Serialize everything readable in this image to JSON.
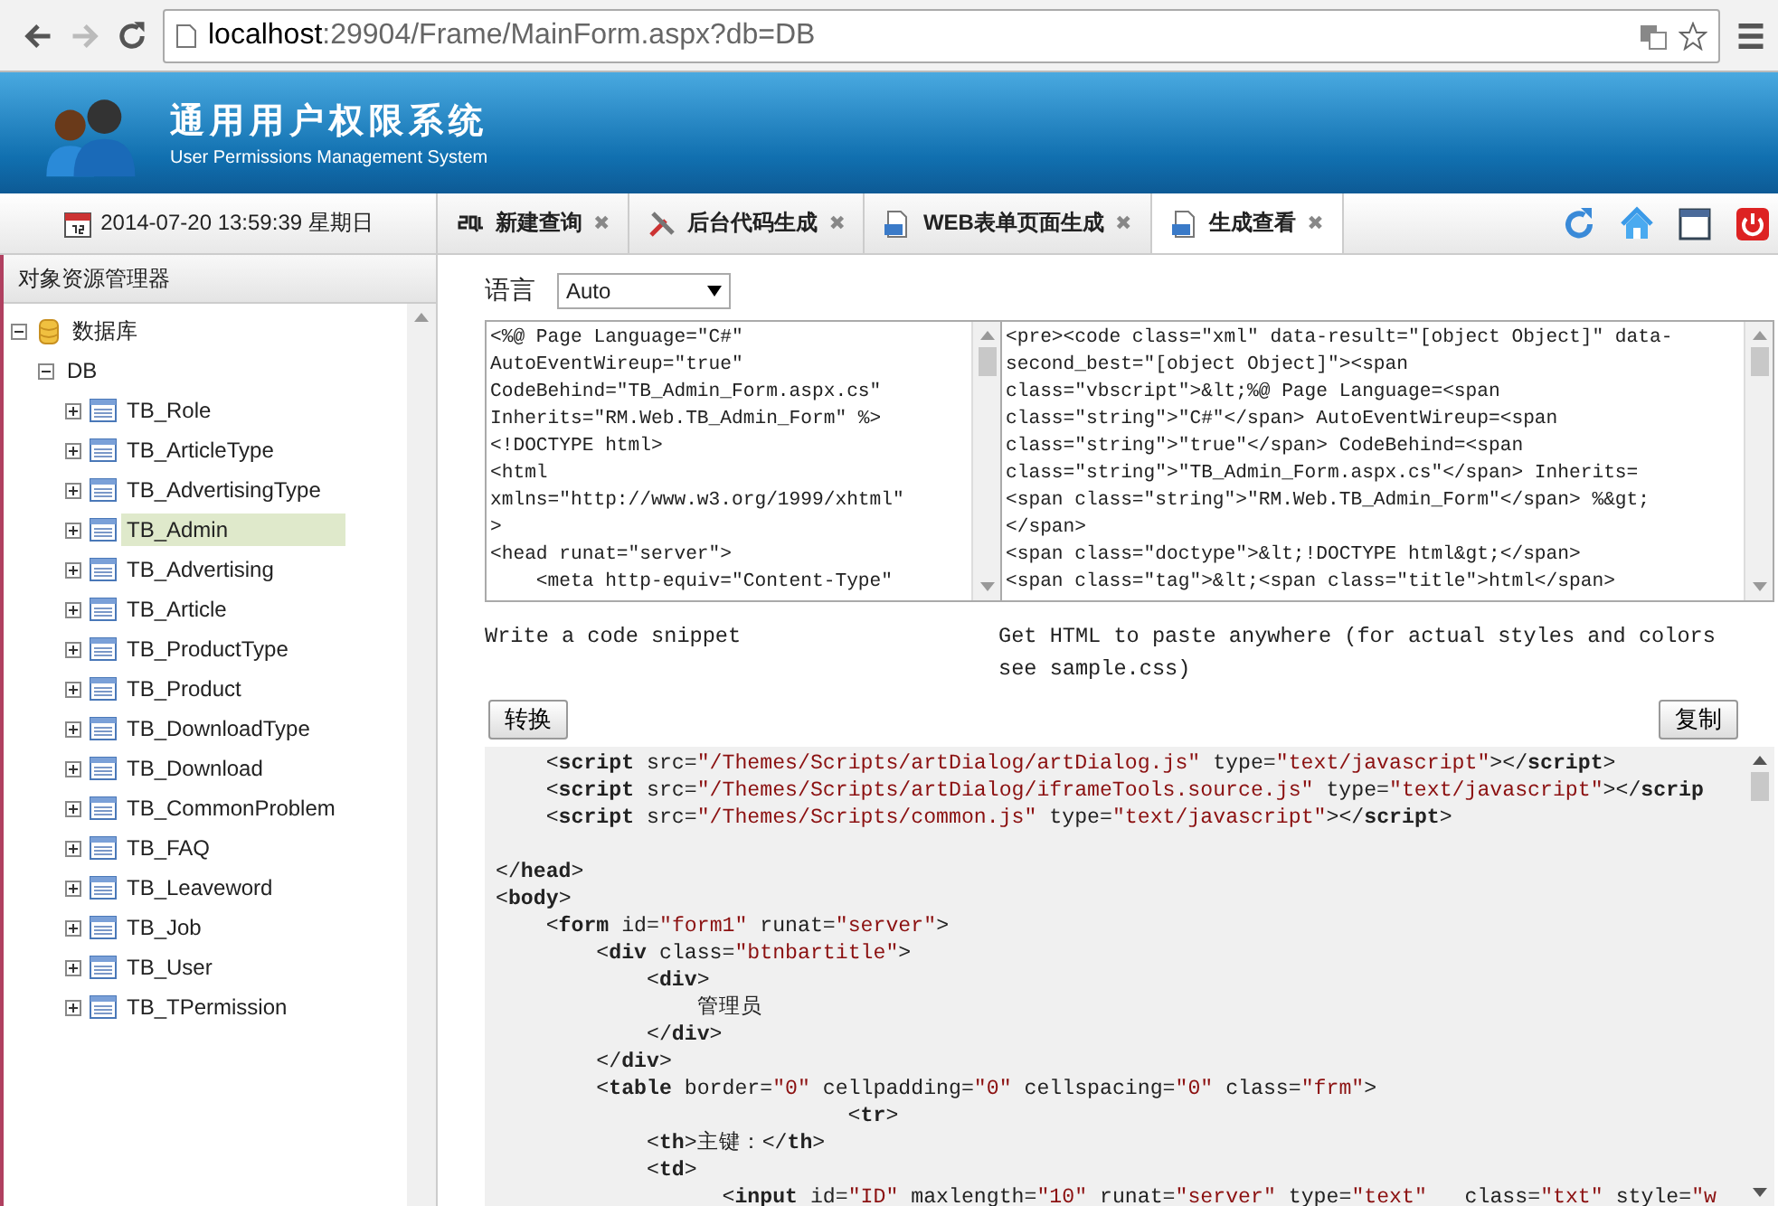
{
  "browser": {
    "url_host": "localhost",
    "url_rest": ":29904/Frame/MainForm.aspx?db=DB"
  },
  "header": {
    "title": "通用用户权限系统",
    "subtitle": "User Permissions Management System"
  },
  "datetime": "2014-07-20 13:59:39 星期日",
  "tabs": [
    {
      "label": "新建查询",
      "kind": "sql",
      "selected": false,
      "close": "✖"
    },
    {
      "label": "后台代码生成",
      "kind": "tools",
      "selected": false,
      "close": "✖"
    },
    {
      "label": "WEB表单页面生成",
      "kind": "doc",
      "selected": false,
      "close": "✖"
    },
    {
      "label": "生成查看",
      "kind": "doc",
      "selected": true,
      "close": "✖"
    }
  ],
  "sidebar": {
    "title": "对象资源管理器",
    "tree": [
      {
        "label": "数据库",
        "kind": "database",
        "expanded": true,
        "selected": false,
        "children": [
          {
            "label": "DB",
            "expanded": true,
            "selected": false,
            "children": [
              {
                "label": "TB_Role",
                "kind": "table",
                "expanded": false,
                "selected": false
              },
              {
                "label": "TB_ArticleType",
                "kind": "table",
                "expanded": false,
                "selected": false
              },
              {
                "label": "TB_AdvertisingType",
                "kind": "table",
                "expanded": false,
                "selected": false
              },
              {
                "label": "TB_Admin",
                "kind": "table",
                "expanded": false,
                "selected": true
              },
              {
                "label": "TB_Advertising",
                "kind": "table",
                "expanded": false,
                "selected": false
              },
              {
                "label": "TB_Article",
                "kind": "table",
                "expanded": false,
                "selected": false
              },
              {
                "label": "TB_ProductType",
                "kind": "table",
                "expanded": false,
                "selected": false
              },
              {
                "label": "TB_Product",
                "kind": "table",
                "expanded": false,
                "selected": false
              },
              {
                "label": "TB_DownloadType",
                "kind": "table",
                "expanded": false,
                "selected": false
              },
              {
                "label": "TB_Download",
                "kind": "table",
                "expanded": false,
                "selected": false
              },
              {
                "label": "TB_CommonProblem",
                "kind": "table",
                "expanded": false,
                "selected": false
              },
              {
                "label": "TB_FAQ",
                "kind": "table",
                "expanded": false,
                "selected": false
              },
              {
                "label": "TB_Leaveword",
                "kind": "table",
                "expanded": false,
                "selected": false
              },
              {
                "label": "TB_Job",
                "kind": "table",
                "expanded": false,
                "selected": false
              },
              {
                "label": "TB_User",
                "kind": "table",
                "expanded": false,
                "selected": false
              },
              {
                "label": "TB_TPermission",
                "kind": "table",
                "expanded": false,
                "selected": false
              }
            ]
          }
        ]
      }
    ]
  },
  "language": {
    "label": "语言",
    "value": "Auto"
  },
  "source_box": {
    "lines": [
      "<%@ Page Language=\"C#\"",
      "AutoEventWireup=\"true\"",
      "CodeBehind=\"TB_Admin_Form.aspx.cs\"",
      "Inherits=\"RM.Web.TB_Admin_Form\" %>",
      "<!DOCTYPE html>",
      "<html",
      "xmlns=\"http://www.w3.org/1999/xhtml\"",
      ">",
      "<head runat=\"server\">",
      "    <meta http-equiv=\"Content-Type\""
    ]
  },
  "html_box": {
    "lines": [
      "<pre><code class=\"xml\" data-result=\"[object Object]\" data-",
      "second_best=\"[object Object]\"><span",
      "class=\"vbscript\">&lt;%@ Page Language=<span",
      "class=\"string\">\"C#\"</span> AutoEventWireup=<span",
      "class=\"string\">\"true\"</span> CodeBehind=<span",
      "class=\"string\">\"TB_Admin_Form.aspx.cs\"</span> Inherits=",
      "<span class=\"string\">\"RM.Web.TB_Admin_Form\"</span> %&gt;",
      "</span>",
      "<span class=\"doctype\">&lt;!DOCTYPE html&gt;</span>",
      "<span class=\"tag\">&lt;<span class=\"title\">html</span>"
    ]
  },
  "caption_left": "Write a code snippet",
  "caption_right": "Get HTML to paste anywhere (for actual styles and colors see sample.css)",
  "convert_button": "转换",
  "copy_button": "复制",
  "code_view": [
    {
      "kind": "code",
      "segments": [
        {
          "kind": "plain",
          "text": "    <"
        },
        {
          "kind": "tag",
          "text": "script"
        },
        {
          "kind": "plain",
          "text": " src="
        },
        {
          "kind": "string",
          "text": "\"/Themes/Scripts/artDialog/artDialog.js\""
        },
        {
          "kind": "plain",
          "text": " type="
        },
        {
          "kind": "string",
          "text": "\"text/javascript\""
        },
        {
          "kind": "plain",
          "text": "></"
        },
        {
          "kind": "tag",
          "text": "script"
        },
        {
          "kind": "plain",
          "text": ">"
        }
      ]
    },
    {
      "kind": "code",
      "segments": [
        {
          "kind": "plain",
          "text": "    <"
        },
        {
          "kind": "tag",
          "text": "script"
        },
        {
          "kind": "plain",
          "text": " src="
        },
        {
          "kind": "string",
          "text": "\"/Themes/Scripts/artDialog/iframeTools.source.js\""
        },
        {
          "kind": "plain",
          "text": " type="
        },
        {
          "kind": "string",
          "text": "\"text/javascript\""
        },
        {
          "kind": "plain",
          "text": "></"
        },
        {
          "kind": "tag",
          "text": "scrip"
        }
      ]
    },
    {
      "kind": "code",
      "segments": [
        {
          "kind": "plain",
          "text": "    <"
        },
        {
          "kind": "tag",
          "text": "script"
        },
        {
          "kind": "plain",
          "text": " src="
        },
        {
          "kind": "string",
          "text": "\"/Themes/Scripts/common.js\""
        },
        {
          "kind": "plain",
          "text": " type="
        },
        {
          "kind": "string",
          "text": "\"text/javascript\""
        },
        {
          "kind": "plain",
          "text": "></"
        },
        {
          "kind": "tag",
          "text": "script"
        },
        {
          "kind": "plain",
          "text": ">"
        }
      ]
    },
    {
      "kind": "blank"
    },
    {
      "kind": "code",
      "segments": [
        {
          "kind": "plain",
          "text": "</"
        },
        {
          "kind": "tag",
          "text": "head"
        },
        {
          "kind": "plain",
          "text": ">"
        }
      ]
    },
    {
      "kind": "code",
      "segments": [
        {
          "kind": "plain",
          "text": "<"
        },
        {
          "kind": "tag",
          "text": "body"
        },
        {
          "kind": "plain",
          "text": ">"
        }
      ]
    },
    {
      "kind": "code",
      "segments": [
        {
          "kind": "plain",
          "text": "    <"
        },
        {
          "kind": "tag",
          "text": "form"
        },
        {
          "kind": "plain",
          "text": " id="
        },
        {
          "kind": "string",
          "text": "\"form1\""
        },
        {
          "kind": "plain",
          "text": " runat="
        },
        {
          "kind": "string",
          "text": "\"server\""
        },
        {
          "kind": "plain",
          "text": ">"
        }
      ]
    },
    {
      "kind": "code",
      "segments": [
        {
          "kind": "plain",
          "text": "        <"
        },
        {
          "kind": "tag",
          "text": "div"
        },
        {
          "kind": "plain",
          "text": " class="
        },
        {
          "kind": "string",
          "text": "\"btnbartitle\""
        },
        {
          "kind": "plain",
          "text": ">"
        }
      ]
    },
    {
      "kind": "code",
      "segments": [
        {
          "kind": "plain",
          "text": "            <"
        },
        {
          "kind": "tag",
          "text": "div"
        },
        {
          "kind": "plain",
          "text": ">"
        }
      ]
    },
    {
      "kind": "code",
      "segments": [
        {
          "kind": "plain",
          "text": "                管理员"
        }
      ]
    },
    {
      "kind": "code",
      "segments": [
        {
          "kind": "plain",
          "text": "            </"
        },
        {
          "kind": "tag",
          "text": "div"
        },
        {
          "kind": "plain",
          "text": ">"
        }
      ]
    },
    {
      "kind": "code",
      "segments": [
        {
          "kind": "plain",
          "text": "        </"
        },
        {
          "kind": "tag",
          "text": "div"
        },
        {
          "kind": "plain",
          "text": ">"
        }
      ]
    },
    {
      "kind": "code",
      "segments": [
        {
          "kind": "plain",
          "text": "        <"
        },
        {
          "kind": "tag",
          "text": "table"
        },
        {
          "kind": "plain",
          "text": " border="
        },
        {
          "kind": "string",
          "text": "\"0\""
        },
        {
          "kind": "plain",
          "text": " cellpadding="
        },
        {
          "kind": "string",
          "text": "\"0\""
        },
        {
          "kind": "plain",
          "text": " cellspacing="
        },
        {
          "kind": "string",
          "text": "\"0\""
        },
        {
          "kind": "plain",
          "text": " class="
        },
        {
          "kind": "string",
          "text": "\"frm\""
        },
        {
          "kind": "plain",
          "text": ">"
        }
      ]
    },
    {
      "kind": "code",
      "segments": [
        {
          "kind": "plain",
          "text": "                            <"
        },
        {
          "kind": "tag",
          "text": "tr"
        },
        {
          "kind": "plain",
          "text": ">"
        }
      ]
    },
    {
      "kind": "code",
      "segments": [
        {
          "kind": "plain",
          "text": "            <"
        },
        {
          "kind": "tag",
          "text": "th"
        },
        {
          "kind": "plain",
          "text": ">主键：</"
        },
        {
          "kind": "tag",
          "text": "th"
        },
        {
          "kind": "plain",
          "text": ">"
        }
      ]
    },
    {
      "kind": "code",
      "segments": [
        {
          "kind": "plain",
          "text": "            <"
        },
        {
          "kind": "tag",
          "text": "td"
        },
        {
          "kind": "plain",
          "text": ">"
        }
      ]
    },
    {
      "kind": "code",
      "segments": [
        {
          "kind": "plain",
          "text": "                  <"
        },
        {
          "kind": "tag",
          "text": "input"
        },
        {
          "kind": "plain",
          "text": " id="
        },
        {
          "kind": "string",
          "text": "\"ID\""
        },
        {
          "kind": "plain",
          "text": " maxlength="
        },
        {
          "kind": "string",
          "text": "\"10\""
        },
        {
          "kind": "plain",
          "text": " runat="
        },
        {
          "kind": "string",
          "text": "\"server\""
        },
        {
          "kind": "plain",
          "text": " type="
        },
        {
          "kind": "string",
          "text": "\"text\""
        },
        {
          "kind": "plain",
          "text": "   class="
        },
        {
          "kind": "string",
          "text": "\"txt\""
        },
        {
          "kind": "plain",
          "text": " style="
        },
        {
          "kind": "string",
          "text": "\"w"
        }
      ]
    }
  ]
}
